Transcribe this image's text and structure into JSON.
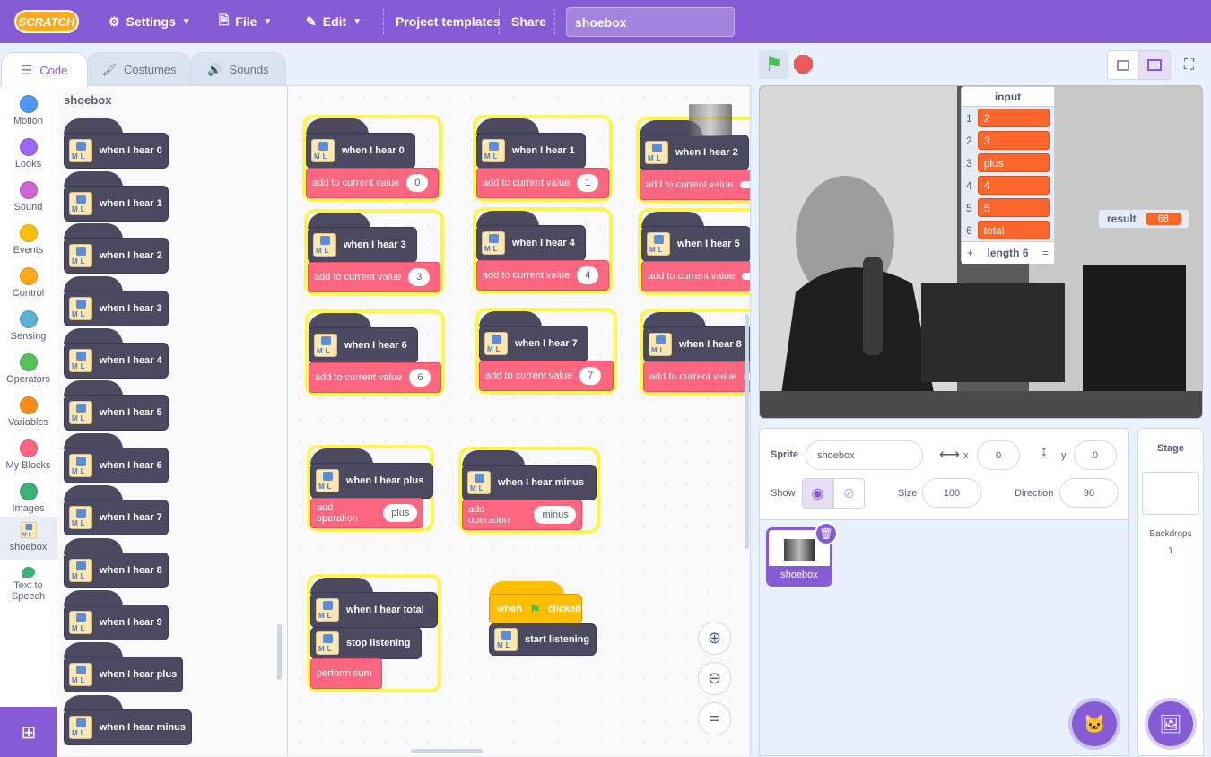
{
  "menubar": {
    "logo": "SCRATCH",
    "settings": "Settings",
    "file": "File",
    "edit": "Edit",
    "project_templates": "Project templates",
    "share": "Share",
    "project_title": "shoebox"
  },
  "tabs": {
    "code": "Code",
    "costumes": "Costumes",
    "sounds": "Sounds"
  },
  "categories": [
    {
      "label": "Motion",
      "color": "#4c97ff"
    },
    {
      "label": "Looks",
      "color": "#9966ff"
    },
    {
      "label": "Sound",
      "color": "#cf63cf"
    },
    {
      "label": "Events",
      "color": "#ffbf00"
    },
    {
      "label": "Control",
      "color": "#ffab19"
    },
    {
      "label": "Sensing",
      "color": "#5cb1d6"
    },
    {
      "label": "Operators",
      "color": "#59c059"
    },
    {
      "label": "Variables",
      "color": "#ff8c1a"
    },
    {
      "label": "My Blocks",
      "color": "#ff6680"
    },
    {
      "label": "Images",
      "color": "#3cb371"
    },
    {
      "label": "shoebox",
      "color": ""
    },
    {
      "label": "Text to Speech",
      "color": ""
    }
  ],
  "palette": {
    "title": "shoebox",
    "blocks": [
      "when I hear 0",
      "when I hear 1",
      "when I hear 2",
      "when I hear 3",
      "when I hear 4",
      "when I hear 5",
      "when I hear 6",
      "when I hear 7",
      "when I hear 8",
      "when I hear 9",
      "when I hear plus",
      "when I hear minus"
    ]
  },
  "scripts": {
    "digits": [
      {
        "hat": "when I hear 0",
        "action": "add to current value",
        "value": "0"
      },
      {
        "hat": "when I hear 1",
        "action": "add to current value",
        "value": "1"
      },
      {
        "hat": "when I hear 2",
        "action": "add to current value",
        "value": ""
      },
      {
        "hat": "when I hear 3",
        "action": "add to current value",
        "value": "3"
      },
      {
        "hat": "when I hear 4",
        "action": "add to current value",
        "value": "4"
      },
      {
        "hat": "when I hear 5",
        "action": "add to current value",
        "value": ""
      },
      {
        "hat": "when I hear 6",
        "action": "add to current value",
        "value": "6"
      },
      {
        "hat": "when I hear 7",
        "action": "add to current value",
        "value": "7"
      },
      {
        "hat": "when I hear 8",
        "action": "add to current value",
        "value": ""
      }
    ],
    "plus": {
      "hat": "when I hear plus",
      "action": "add operation",
      "value": "plus"
    },
    "minus": {
      "hat": "when I hear minus",
      "action": "add operation",
      "value": "minus"
    },
    "total": {
      "hat": "when I hear total",
      "stop": "stop listening",
      "sum": "perform sum"
    },
    "flag": {
      "when": "when",
      "clicked": "clicked",
      "start": "start listening"
    }
  },
  "zoom": {
    "in": "+",
    "out": "−",
    "reset": "="
  },
  "stage": {
    "list_monitor": {
      "title": "input",
      "items": [
        {
          "index": "1",
          "value": "2"
        },
        {
          "index": "2",
          "value": "3"
        },
        {
          "index": "3",
          "value": "plus"
        },
        {
          "index": "4",
          "value": "4"
        },
        {
          "index": "5",
          "value": "5"
        },
        {
          "index": "6",
          "value": "total"
        }
      ],
      "add": "+",
      "length": "length 6",
      "equals": "="
    },
    "variable_monitor": {
      "label": "result",
      "value": "68"
    }
  },
  "sprite_info": {
    "sprite_label": "Sprite",
    "sprite_name": "shoebox",
    "x_label": "x",
    "x_value": "0",
    "y_label": "y",
    "y_value": "0",
    "show_label": "Show",
    "size_label": "Size",
    "size_value": "100",
    "direction_label": "Direction",
    "direction_value": "90"
  },
  "sprite_list": {
    "sprites": [
      {
        "name": "shoebox"
      }
    ]
  },
  "stage_panel": {
    "title": "Stage",
    "backdrops_label": "Backdrops",
    "backdrops_count": "1"
  }
}
